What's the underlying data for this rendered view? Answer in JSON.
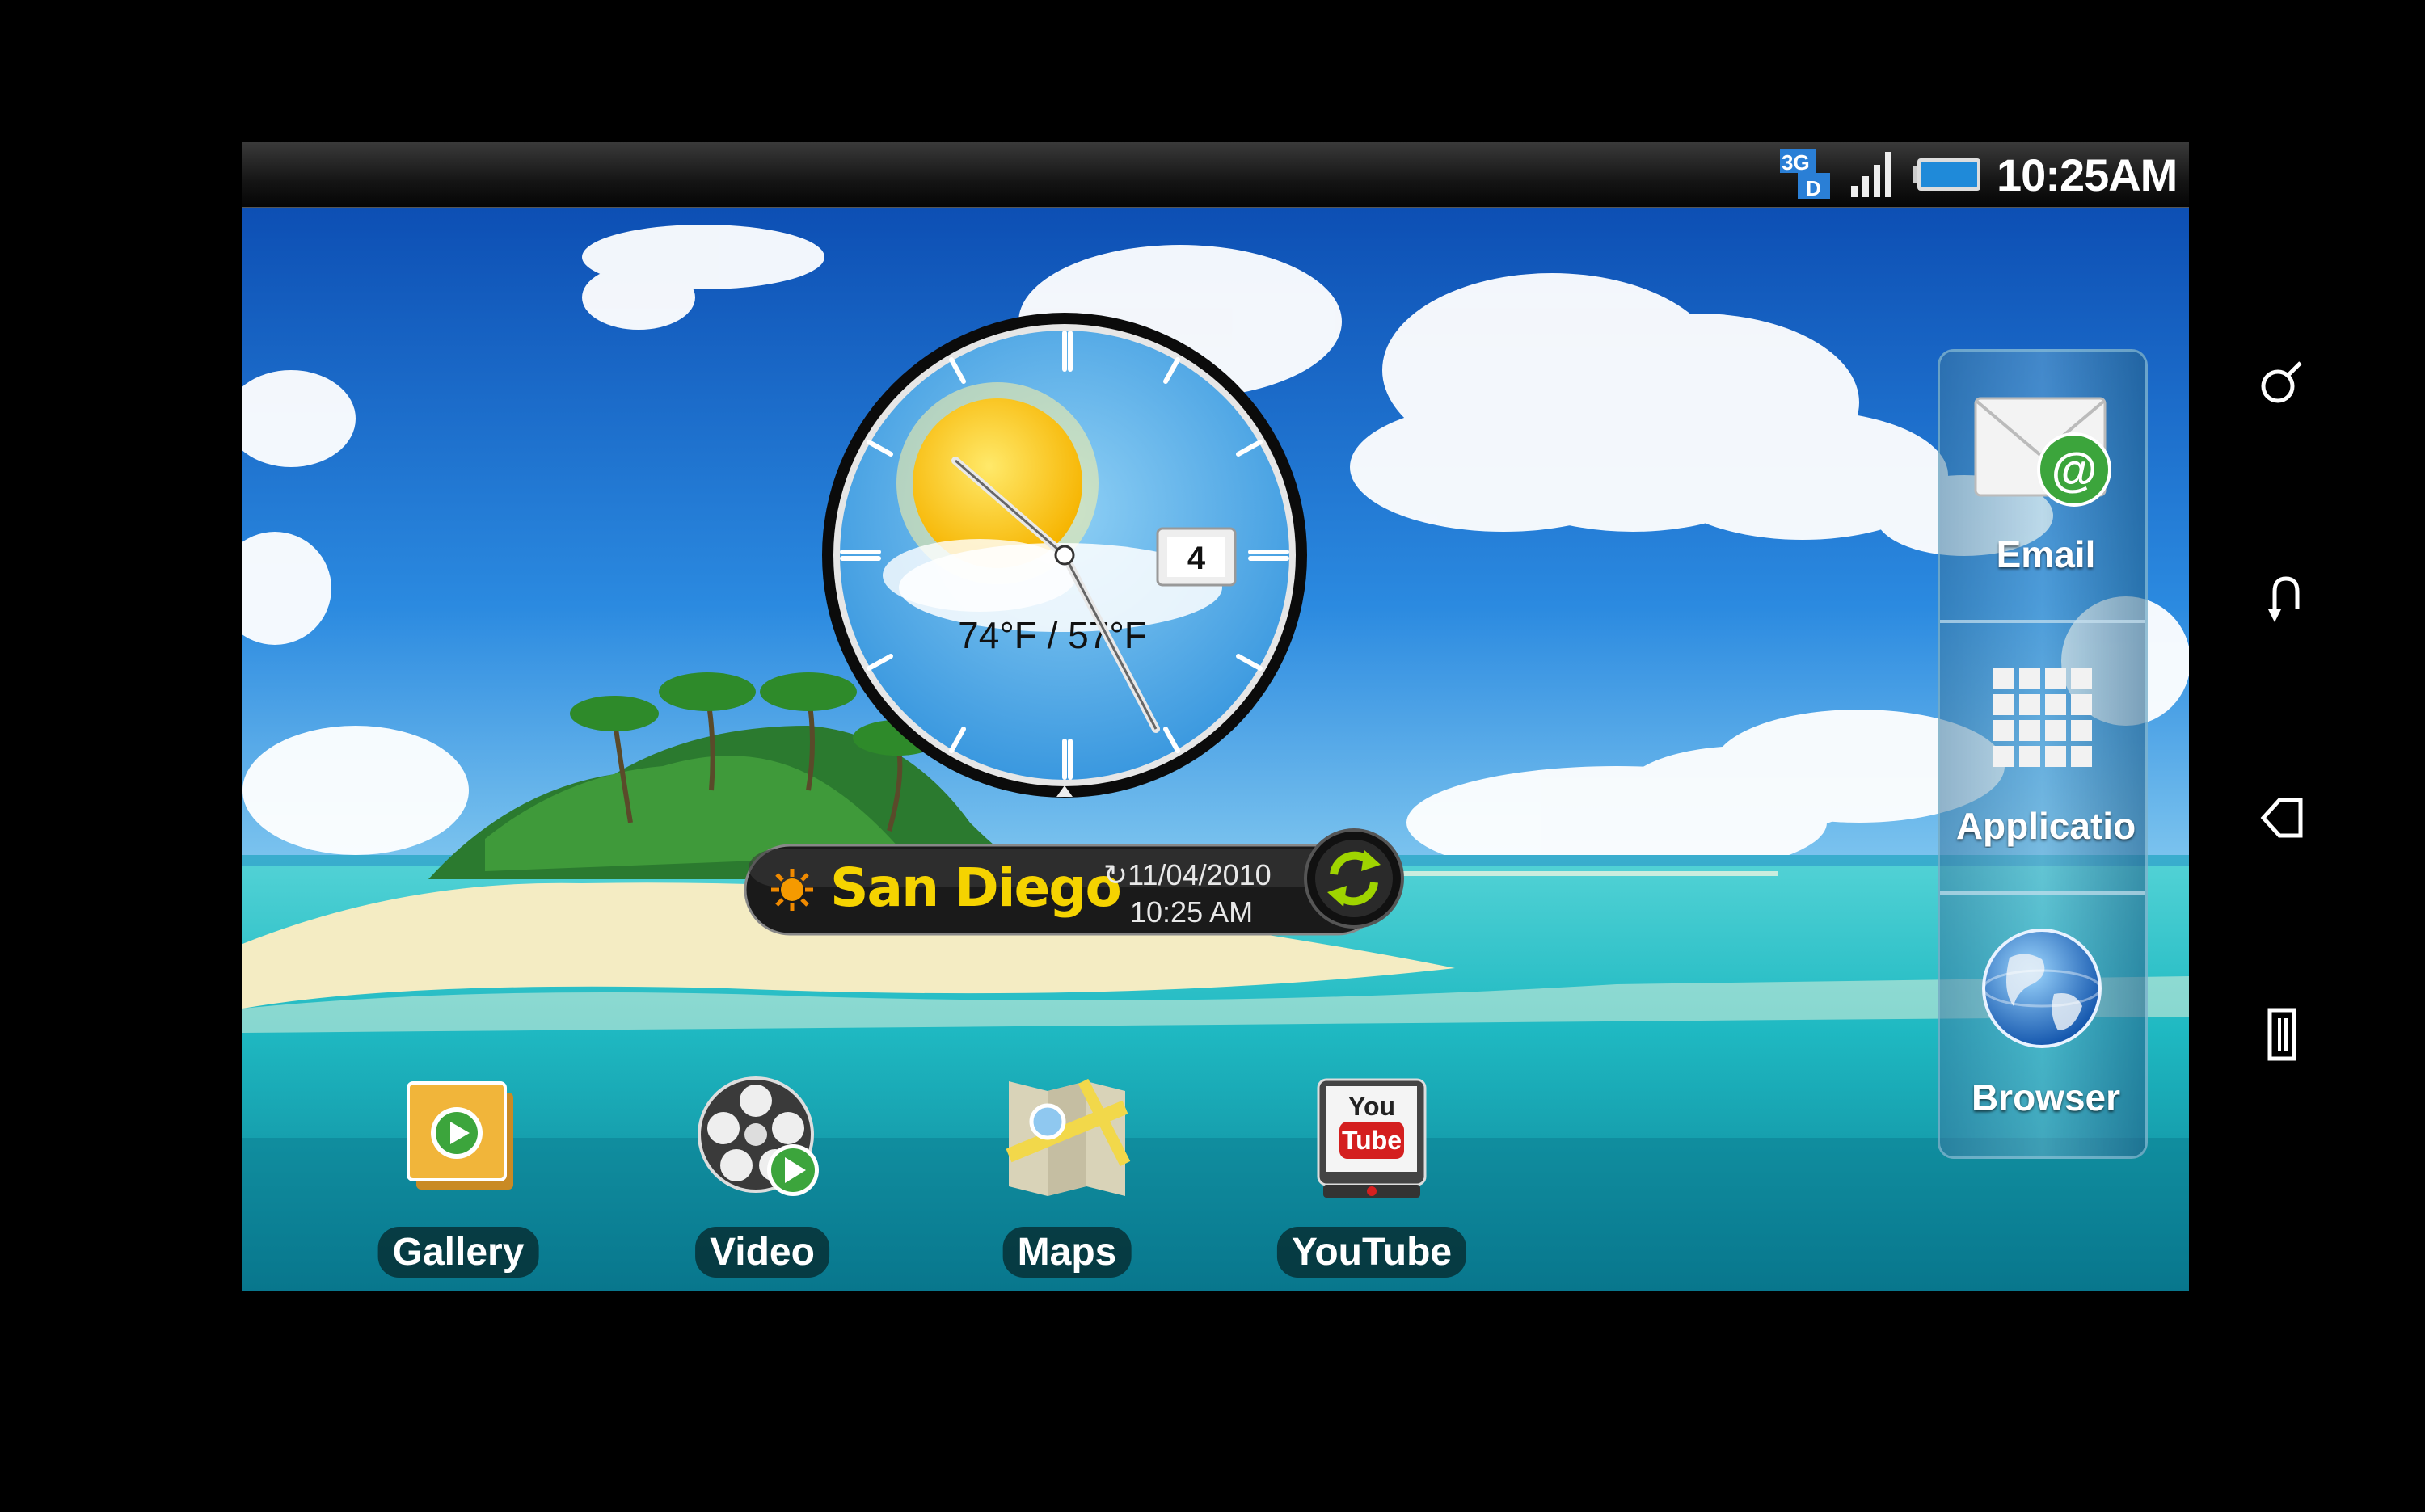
{
  "status_bar": {
    "network_badge": "3G",
    "network_sub": "D",
    "signal_icon": "signal-bars-icon",
    "battery_icon": "battery-icon",
    "time": "10:25AM"
  },
  "clock_widget": {
    "date_day": "4",
    "temperature": "74°F / 57°F",
    "weather_icon": "sun-cloud-icon"
  },
  "weather_bar": {
    "city": "San Diego",
    "date": "11/04/2010",
    "time": "10:25 AM",
    "refresh_icon": "refresh-icon"
  },
  "dock": [
    {
      "label": "Gallery",
      "icon": "gallery-icon"
    },
    {
      "label": "Video",
      "icon": "video-icon"
    },
    {
      "label": "Maps",
      "icon": "maps-icon"
    },
    {
      "label": "YouTube",
      "icon": "youtube-icon"
    }
  ],
  "launcher": [
    {
      "label": "Email",
      "icon": "email-icon"
    },
    {
      "label": "Applicatio",
      "icon": "applications-grid-icon"
    },
    {
      "label": "Browser",
      "icon": "globe-icon"
    }
  ],
  "hardware_keys": [
    "search-icon",
    "back-icon",
    "home-icon",
    "menu-icon"
  ],
  "colors": {
    "city_text": "#f5d300",
    "sky": "#1d6fd0",
    "sea": "#27c2c9"
  }
}
